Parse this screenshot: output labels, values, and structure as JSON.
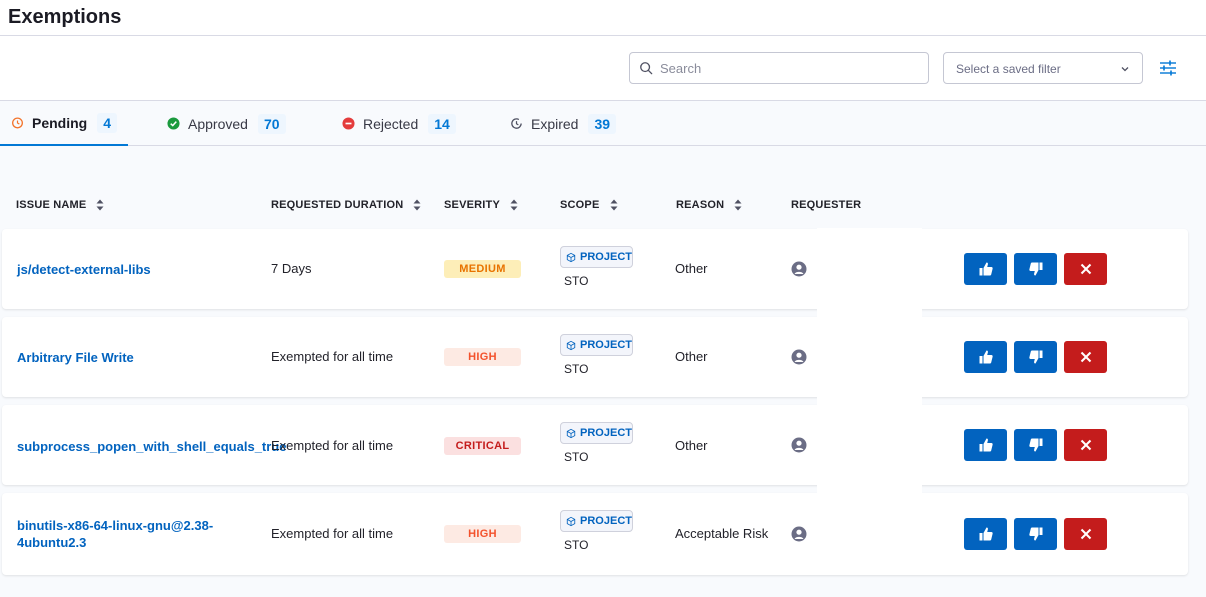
{
  "page": {
    "title": "Exemptions"
  },
  "toolbar": {
    "search_placeholder": "Search",
    "filter_placeholder": "Select a saved filter"
  },
  "tabs": [
    {
      "label": "Pending",
      "count": "4",
      "icon": "pending-clock-icon",
      "color": "#f3732a"
    },
    {
      "label": "Approved",
      "count": "70",
      "icon": "check-circle-icon",
      "color": "#1b9a3e"
    },
    {
      "label": "Rejected",
      "count": "14",
      "icon": "minus-circle-icon",
      "color": "#e43c3c"
    },
    {
      "label": "Expired",
      "count": "39",
      "icon": "expired-clock-icon",
      "color": "#4f5162"
    }
  ],
  "table": {
    "columns": [
      "ISSUE NAME",
      "REQUESTED DURATION",
      "SEVERITY",
      "SCOPE",
      "REASON",
      "REQUESTER"
    ],
    "rows": [
      {
        "issue": "js/detect-external-libs",
        "duration": "7 Days",
        "severity": "MEDIUM",
        "scope": "PROJECT",
        "scope_name": "STO",
        "reason": "Other"
      },
      {
        "issue": "Arbitrary File Write",
        "duration": "Exempted for all time",
        "severity": "HIGH",
        "scope": "PROJECT",
        "scope_name": "STO",
        "reason": "Other"
      },
      {
        "issue": "subprocess_popen_with_shell_equals_true",
        "duration": "Exempted for all time",
        "severity": "CRITICAL",
        "scope": "PROJECT",
        "scope_name": "STO",
        "reason": "Other"
      },
      {
        "issue": "binutils-x86-64-linux-gnu@2.38-4ubuntu2.3",
        "duration": "Exempted for all time",
        "severity": "HIGH",
        "scope": "PROJECT",
        "scope_name": "STO",
        "reason": "Acceptable Risk"
      }
    ]
  },
  "severity_colors": {
    "MEDIUM": {
      "bg": "#fdeeb8",
      "fg": "#e87300"
    },
    "HIGH": {
      "bg": "#fdeae3",
      "fg": "#f3522c"
    },
    "CRITICAL": {
      "bg": "#fbe0e0",
      "fg": "#c41c1c"
    }
  }
}
